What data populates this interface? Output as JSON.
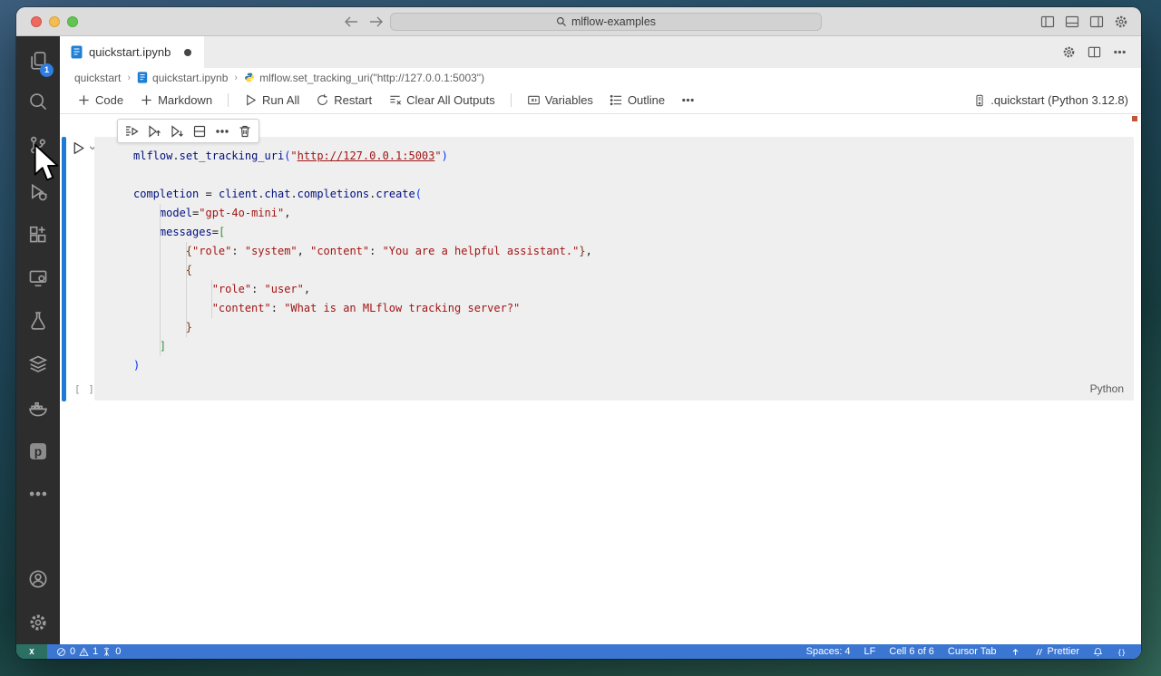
{
  "window": {
    "search_label": "mlflow-examples"
  },
  "titlebar": {
    "actions": [
      "toggle-panel-left",
      "toggle-panel-bottom",
      "toggle-panel-right",
      "customize-layout"
    ]
  },
  "activity_bar": {
    "top": [
      {
        "icon": "explorer",
        "badge": "1"
      },
      {
        "icon": "search"
      },
      {
        "icon": "source-control"
      },
      {
        "icon": "run-debug"
      },
      {
        "icon": "extensions"
      },
      {
        "icon": "remote-explorer"
      },
      {
        "icon": "testing"
      },
      {
        "icon": "database"
      },
      {
        "icon": "docker"
      },
      {
        "icon": "prettier"
      },
      {
        "icon": "more"
      }
    ],
    "bottom": [
      {
        "icon": "account"
      },
      {
        "icon": "settings"
      }
    ]
  },
  "tab": {
    "label": "quickstart.ipynb",
    "modified": true
  },
  "tab_actions": [
    "notebook-settings",
    "split-editor",
    "more"
  ],
  "breadcrumbs": [
    {
      "icon": "",
      "label": "quickstart"
    },
    {
      "icon": "notebook",
      "label": "quickstart.ipynb"
    },
    {
      "icon": "python",
      "label": "mlflow.set_tracking_uri(\"http://127.0.0.1:5003\")"
    }
  ],
  "notebook_toolbar": {
    "items": [
      {
        "icon": "add",
        "label": "Code"
      },
      {
        "icon": "add",
        "label": "Markdown"
      },
      {
        "type": "divider"
      },
      {
        "icon": "run-all",
        "label": "Run All"
      },
      {
        "icon": "restart",
        "label": "Restart"
      },
      {
        "icon": "clear-outputs",
        "label": "Clear All Outputs"
      },
      {
        "type": "divider"
      },
      {
        "icon": "variables",
        "label": "Variables"
      },
      {
        "icon": "outline",
        "label": "Outline"
      },
      {
        "icon": "more",
        "label": ""
      }
    ],
    "kernel": {
      "icon": "kernel",
      "label": ".quickstart (Python 3.12.8)"
    }
  },
  "cell": {
    "hover_actions": [
      "run-by-line",
      "run-above",
      "run-below",
      "split-cell",
      "more",
      "delete"
    ],
    "exec_count": "[ ]",
    "language": "Python",
    "code_lines": [
      [
        [
          "v",
          "mlflow"
        ],
        [
          "p",
          "."
        ],
        [
          "v",
          "set_tracking_uri"
        ],
        [
          "b1",
          "("
        ],
        [
          "s",
          "\""
        ],
        [
          "lnk",
          "http://127.0.0.1:5003"
        ],
        [
          "s",
          "\""
        ],
        [
          "b1",
          ")"
        ]
      ],
      [],
      [
        [
          "v",
          "completion"
        ],
        [
          "p",
          " = "
        ],
        [
          "v",
          "client"
        ],
        [
          "p",
          "."
        ],
        [
          "v",
          "chat"
        ],
        [
          "p",
          "."
        ],
        [
          "v",
          "completions"
        ],
        [
          "p",
          "."
        ],
        [
          "v",
          "create"
        ],
        [
          "b1",
          "("
        ]
      ],
      [
        [
          "w",
          "    "
        ],
        [
          "v",
          "model"
        ],
        [
          "p",
          "="
        ],
        [
          "s",
          "\"gpt-4o-mini\""
        ],
        [
          "p",
          ","
        ]
      ],
      [
        [
          "w",
          "    "
        ],
        [
          "v",
          "messages"
        ],
        [
          "p",
          "="
        ],
        [
          "b2",
          "["
        ]
      ],
      [
        [
          "w",
          "        "
        ],
        [
          "b3",
          "{"
        ],
        [
          "s",
          "\"role\""
        ],
        [
          "p",
          ": "
        ],
        [
          "s",
          "\"system\""
        ],
        [
          "p",
          ", "
        ],
        [
          "s",
          "\"content\""
        ],
        [
          "p",
          ": "
        ],
        [
          "s",
          "\"You are a helpful assistant.\""
        ],
        [
          "b3",
          "}"
        ],
        [
          "p",
          ","
        ]
      ],
      [
        [
          "w",
          "        "
        ],
        [
          "b3",
          "{"
        ]
      ],
      [
        [
          "w",
          "            "
        ],
        [
          "s",
          "\"role\""
        ],
        [
          "p",
          ": "
        ],
        [
          "s",
          "\"user\""
        ],
        [
          "p",
          ","
        ]
      ],
      [
        [
          "w",
          "            "
        ],
        [
          "s",
          "\"content\""
        ],
        [
          "p",
          ": "
        ],
        [
          "s",
          "\"What is an MLflow tracking server?\""
        ]
      ],
      [
        [
          "w",
          "        "
        ],
        [
          "b3",
          "}"
        ]
      ],
      [
        [
          "w",
          "    "
        ],
        [
          "b2",
          "]"
        ]
      ],
      [
        [
          "b1",
          ")"
        ]
      ]
    ]
  },
  "status_bar": {
    "left": [
      {
        "icon": "error",
        "text": "0"
      },
      {
        "icon": "warning",
        "text": "1"
      },
      {
        "icon": "ports",
        "text": "0"
      }
    ],
    "right": [
      {
        "icon": "",
        "text": "Spaces: 4"
      },
      {
        "icon": "",
        "text": "LF"
      },
      {
        "icon": "",
        "text": "Cell 6 of 6"
      },
      {
        "icon": "",
        "text": "Cursor Tab"
      },
      {
        "icon": "arrow-up",
        "text": ""
      },
      {
        "icon": "prettier-slash",
        "text": "Prettier"
      },
      {
        "icon": "bell",
        "text": ""
      },
      {
        "icon": "braces",
        "text": ""
      }
    ]
  },
  "colors": {
    "accent": "#3b76d3",
    "focus_border": "#1f7ad6",
    "string": "#a31515",
    "identifier": "#001080"
  }
}
